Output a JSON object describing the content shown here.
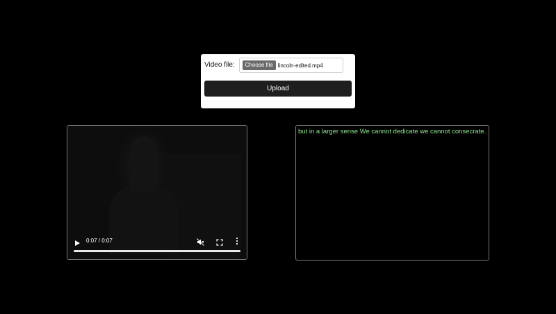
{
  "upload": {
    "label": "Video file:",
    "choose_button": "Choose file",
    "file_name": "lincoln-edited.mp4",
    "upload_button": "Upload"
  },
  "video": {
    "time": "0:07 / 0:07",
    "progress_fraction": 1.0,
    "icons": {
      "play": "play-icon",
      "mute": "muted-speaker-icon",
      "fullscreen": "fullscreen-icon",
      "more": "more-vertical-icon"
    }
  },
  "transcript": {
    "text": "but in a larger sense We cannot dedicate we cannot consecrate."
  },
  "colors": {
    "background": "#000000",
    "transcript_text": "#8fe58f",
    "upload_button": "#1e1e1e"
  }
}
